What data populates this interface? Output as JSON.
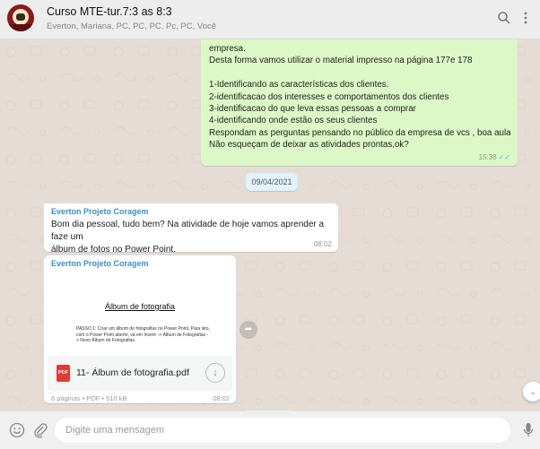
{
  "header": {
    "title": "Curso MTE-tur.7:3 as 8:3",
    "subtitle": "Everton, Mariana, PC, PC, PC, Pc, PC, Você",
    "icons": {
      "avatar": "group-avatar",
      "search": "search-icon",
      "menu": "menu-icon"
    }
  },
  "messages": {
    "outgoing": {
      "lines": [
        "empresa.",
        "Desta forma vamos utilizar o material impresso na página 177e 178",
        "",
        " 1-Identificando as características dos clientes.",
        "2-identificacao dos interesses e comportamentos dos clientes",
        "3-identificacao do que leva essas pessoas a comprar",
        "4-identificando onde estão os seus clientes",
        "Respondam as perguntas pensando no público da empresa de vcs , boa aula !",
        "Não esqueçam de deixar as atividades prontas,ok?"
      ],
      "time": "15:38",
      "ticks": "✓✓"
    },
    "date_divider": "09/04/2021",
    "incoming_text": {
      "sender": "Everton Projeto Coragem",
      "line1": "Bom dia pessoal, tudo bem? Na atividade de hoje vamos aprender a faze um",
      "line2": "álbum de fotos no Power Point.",
      "time": "08:02"
    },
    "incoming_file": {
      "sender": "Everton Projeto Coragem",
      "preview_title": "Álbum de fotografia",
      "preview_text": "PASSO 1: Criar um álbum de fotografias no Power Point. Para isto, com o Power Point aberto, vá em Inserir -> Álbum de Fotografias -> Novo Álbum de Fotografias.",
      "file_icon_label": "PDF",
      "file_name": "11- Álbum de fotografia.pdf",
      "meta": "6 páginas • PDF • 510 kB",
      "time": "08:02"
    }
  },
  "footer": {
    "placeholder": "Digite uma mensagem",
    "icons": {
      "emoji": "emoji-icon",
      "attach": "paperclip-icon",
      "mic": "microphone-icon"
    }
  },
  "colors": {
    "outgoing_bubble": "#dcf8c6",
    "incoming_bubble": "#ffffff",
    "chat_background": "#e5ddd5",
    "sender_name": "#3b8fd0",
    "read_ticks": "#4fc3f7"
  }
}
